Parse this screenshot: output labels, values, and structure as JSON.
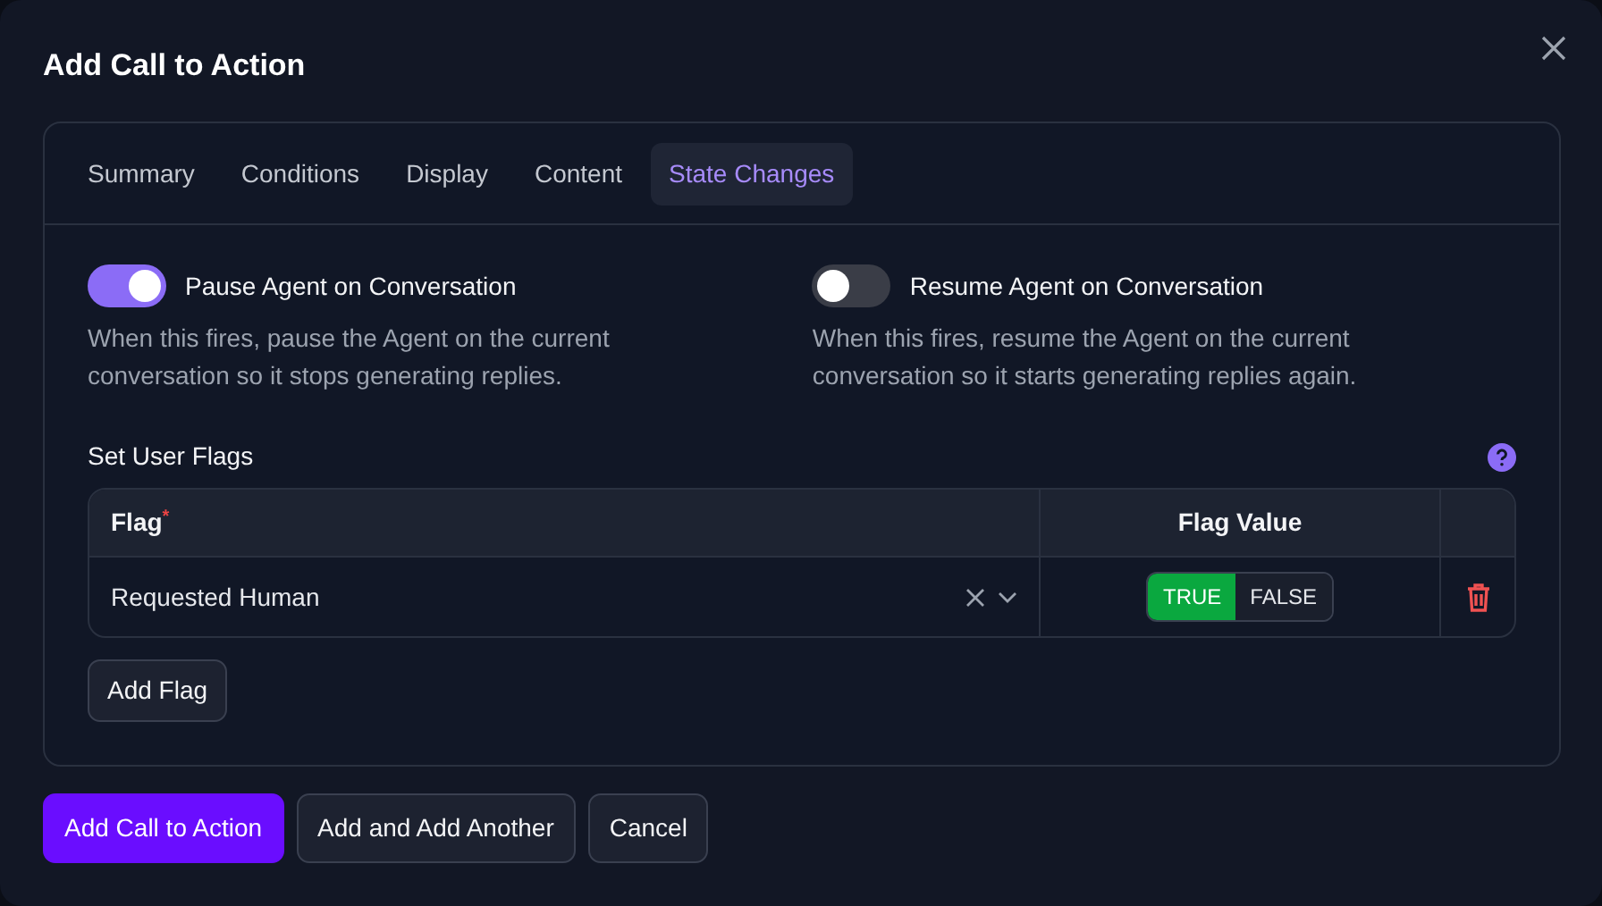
{
  "dialog": {
    "title": "Add Call to Action"
  },
  "tabs": [
    {
      "label": "Summary",
      "selected": false
    },
    {
      "label": "Conditions",
      "selected": false
    },
    {
      "label": "Display",
      "selected": false
    },
    {
      "label": "Content",
      "selected": false
    },
    {
      "label": "State Changes",
      "selected": true
    }
  ],
  "toggles": [
    {
      "label": "Pause Agent on Conversation",
      "on": true,
      "description": "When this fires, pause the Agent on the current conversation so it stops generating replies."
    },
    {
      "label": "Resume Agent on Conversation",
      "on": false,
      "description": "When this fires, resume the Agent on the current conversation so it starts generating replies again."
    }
  ],
  "user_flags": {
    "title": "Set User Flags",
    "columns": [
      {
        "label": "Flag$^{*}$"
      },
      {
        "label": "Flag Value"
      }
    ],
    "rows": [
      {
        "flag": "Requested Human",
        "options": [
          {
            "label": "TRUE",
            "selected": true
          },
          {
            "label": "FALSE",
            "selected": false
          }
        ]
      }
    ],
    "add_button": "Add Flag"
  },
  "buttons": [
    {
      "label": "Add Call to Action",
      "kind": "primary"
    },
    {
      "label": "Add and Add Another",
      "kind": "secondary"
    },
    {
      "label": "Cancel",
      "kind": "secondary"
    }
  ]
}
